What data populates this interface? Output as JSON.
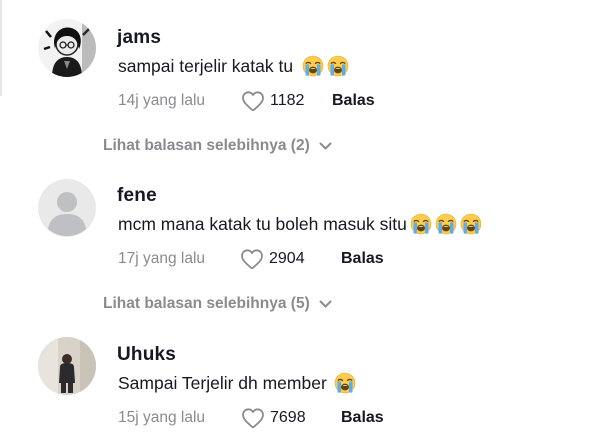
{
  "comments": [
    {
      "username": "jams",
      "text": "sampai terjelir katak tu",
      "emoji_count": 2,
      "time": "14j yang lalu",
      "likes": "1182",
      "reply_label": "Balas",
      "view_replies": "Lihat balasan selebihnya (2)"
    },
    {
      "username": "fene",
      "text": "mcm mana katak tu boleh masuk situ",
      "emoji_count": 3,
      "time": "17j yang lalu",
      "likes": "2904",
      "reply_label": "Balas",
      "view_replies": "Lihat balasan selebihnya (5)"
    },
    {
      "username": "Uhuks",
      "text": "Sampai Terjelir dh member",
      "emoji_count": 1,
      "time": "15j yang lalu",
      "likes": "7698",
      "reply_label": "Balas"
    }
  ],
  "icons": {
    "like": "heart-outline-icon",
    "expand": "chevron-down-icon",
    "emoji": "loudly-crying-face-emoji"
  },
  "colors": {
    "text": "#161823",
    "muted": "#8a8b91"
  }
}
